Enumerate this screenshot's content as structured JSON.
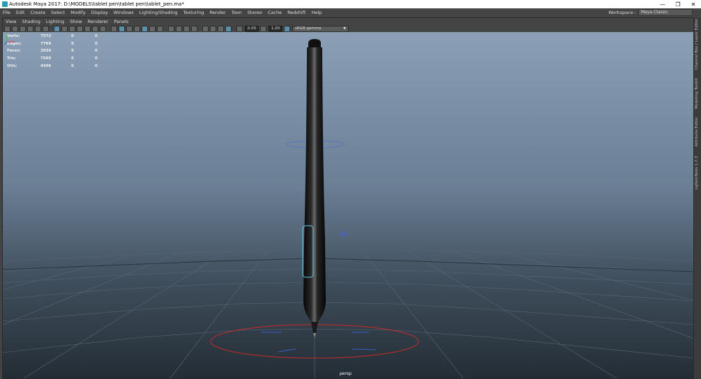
{
  "window": {
    "title": "Autodesk Maya 2017: D:\\MODELS\\tablet pen\\tablet pen\\tablet_pen.ma*",
    "minimize": "—",
    "maximize": "❐",
    "close": "✕"
  },
  "menubar": {
    "items": [
      "File",
      "Edit",
      "Create",
      "Select",
      "Modify",
      "Display",
      "Windows",
      "Lighting/Shading",
      "Texturing",
      "Render",
      "Toon",
      "Stereo",
      "Cache",
      "Redshift",
      "Help"
    ]
  },
  "workspace": {
    "label": "Workspace :",
    "value": "Maya Classic"
  },
  "panel_menu": {
    "items": [
      "View",
      "Shading",
      "Lighting",
      "Show",
      "Renderer",
      "Panels"
    ]
  },
  "toolbar": {
    "field1": "0.00",
    "field2": "1.00",
    "colorspace": "sRGB gamma"
  },
  "hud": {
    "rows": [
      {
        "label": "Verts:",
        "a": "7572",
        "b": "0",
        "c": "0"
      },
      {
        "label": "Edges:",
        "a": "7769",
        "b": "0",
        "c": "0"
      },
      {
        "label": "Faces:",
        "a": "3830",
        "b": "0",
        "c": "0"
      },
      {
        "label": "Tris:",
        "a": "7660",
        "b": "0",
        "c": "0"
      },
      {
        "label": "UVs:",
        "a": "4506",
        "b": "0",
        "c": "0"
      }
    ]
  },
  "camera_label": "persp",
  "right_tabs": [
    "Channel Box / Layer Editor",
    "Modeling Toolkit",
    "Attribute Editor",
    "ngSkinTools 1.7.3"
  ],
  "colors": {
    "viewport_top": "#8b9fb6",
    "viewport_bottom": "#242d35",
    "selection_cyan": "#5fd0e8",
    "manipulator_red": "#cc2a2a",
    "manipulator_blue": "#3a5fc8"
  }
}
